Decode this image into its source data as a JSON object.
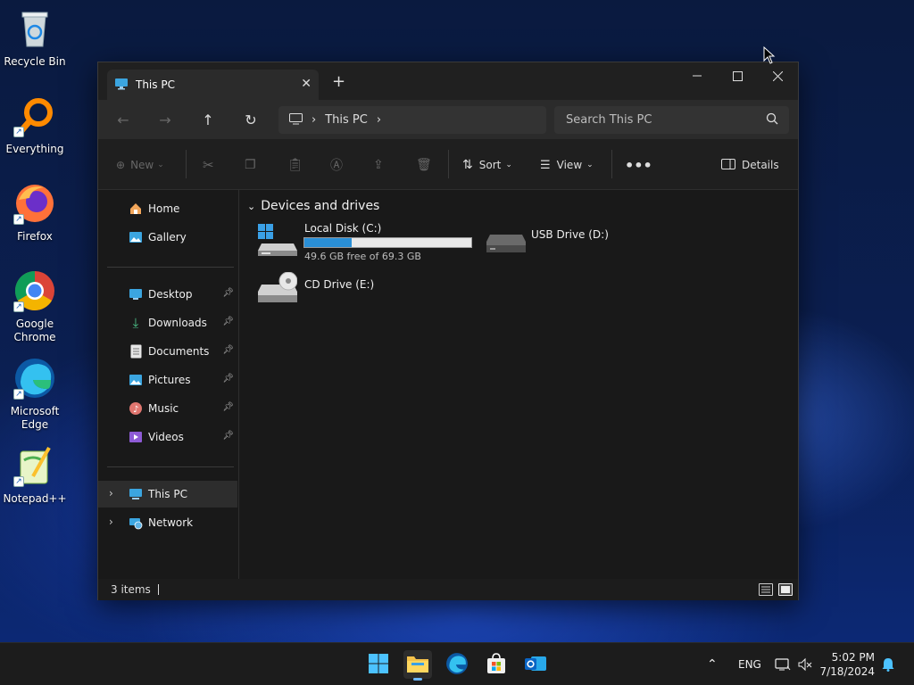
{
  "desktop": {
    "icons": [
      {
        "label": "Recycle Bin"
      },
      {
        "label": "Everything"
      },
      {
        "label": "Firefox"
      },
      {
        "label": "Google Chrome"
      },
      {
        "label": "Microsoft Edge"
      },
      {
        "label": "Notepad++"
      }
    ]
  },
  "window": {
    "tab_title": "This PC",
    "breadcrumb": "This PC",
    "search_placeholder": "Search This PC",
    "toolbar": {
      "new_label": "New",
      "sort_label": "Sort",
      "view_label": "View",
      "details_label": "Details"
    },
    "sidebar": {
      "top": [
        {
          "label": "Home"
        },
        {
          "label": "Gallery"
        }
      ],
      "quick": [
        {
          "label": "Desktop"
        },
        {
          "label": "Downloads"
        },
        {
          "label": "Documents"
        },
        {
          "label": "Pictures"
        },
        {
          "label": "Music"
        },
        {
          "label": "Videos"
        }
      ],
      "bottom": [
        {
          "label": "This PC"
        },
        {
          "label": "Network"
        }
      ]
    },
    "content": {
      "group_title": "Devices and drives",
      "drives": [
        {
          "name": "Local Disk (C:)",
          "free_text": "49.6 GB free of 69.3 GB",
          "used_fraction": 0.284
        },
        {
          "name": "USB Drive (D:)"
        },
        {
          "name": "CD Drive (E:)"
        }
      ]
    },
    "status": {
      "items_count": "3 items"
    }
  },
  "taskbar": {
    "language": "ENG",
    "time": "5:02 PM",
    "date": "7/18/2024"
  },
  "colors": {
    "accent": "#2a8fd6",
    "window_bg": "#191919",
    "taskbar_bg": "#1c1c1c"
  }
}
